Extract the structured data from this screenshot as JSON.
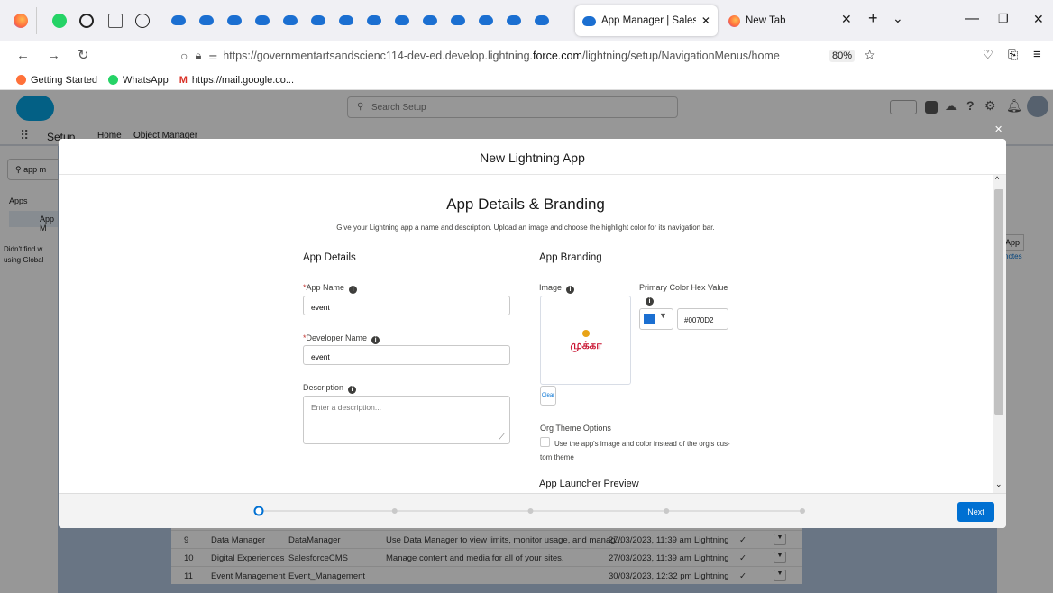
{
  "browser": {
    "tabs": [
      {
        "title": "App Manager | Salesforce"
      },
      {
        "title": "New Tab"
      }
    ],
    "url_prefix": "https://governmentartsandscienc114-dev-ed.develop.lightning.",
    "url_domain": "force.com",
    "url_suffix": "/lightning/setup/NavigationMenus/home",
    "zoom": "80%",
    "bookmarks": [
      "Getting Started",
      "WhatsApp",
      "https://mail.google.co..."
    ]
  },
  "sf": {
    "search_placeholder": "Search Setup",
    "app_name": "Setup",
    "nav_home": "Home",
    "nav_object_manager": "Object Manager",
    "quickfind_value": "app m",
    "apps_section": "Apps",
    "apps_item": "App M",
    "not_found_line1": "Didn't find w",
    "not_found_line2": "using Global",
    "right_btn": "App",
    "right_notes": "notes",
    "rows": [
      {
        "num": "9",
        "label": "Data Manager",
        "dev": "DataManager",
        "desc": "Use Data Manager to view limits, monitor usage, and manag...",
        "date": "27/03/2023, 11:39 am",
        "type": "Lightning"
      },
      {
        "num": "10",
        "label": "Digital Experiences",
        "dev": "SalesforceCMS",
        "desc": "Manage content and media for all of your sites.",
        "date": "27/03/2023, 11:39 am",
        "type": "Lightning"
      },
      {
        "num": "11",
        "label": "Event Management",
        "dev": "Event_Management",
        "desc": "",
        "date": "30/03/2023, 12:32 pm",
        "type": "Lightning"
      }
    ]
  },
  "modal": {
    "title": "New Lightning App",
    "heading": "App Details & Branding",
    "subheading": "Give your Lightning app a name and description. Upload an image and choose the highlight color for its navigation bar.",
    "details_title": "App Details",
    "app_name_label": "App Name",
    "app_name_value": "event",
    "dev_name_label": "Developer Name",
    "dev_name_value": "event",
    "description_label": "Description",
    "description_placeholder": "Enter a description...",
    "branding_title": "App Branding",
    "image_label": "Image",
    "clear_label": "Clear",
    "color_label": "Primary Color Hex Value",
    "color_value": "#0070D2",
    "org_theme_title": "Org Theme Options",
    "org_theme_text_1": "Use the app's image and color instead of the org's cus-",
    "org_theme_text_2": "tom theme",
    "preview_title": "App Launcher Preview",
    "next_label": "Next",
    "progress": {
      "current_step": 1,
      "total_steps": 5
    },
    "logo_text": "முக்கா"
  },
  "colors": {
    "brand": "#0070D2",
    "salesforce_blue": "#1b6fd1",
    "required": "#c23934"
  }
}
